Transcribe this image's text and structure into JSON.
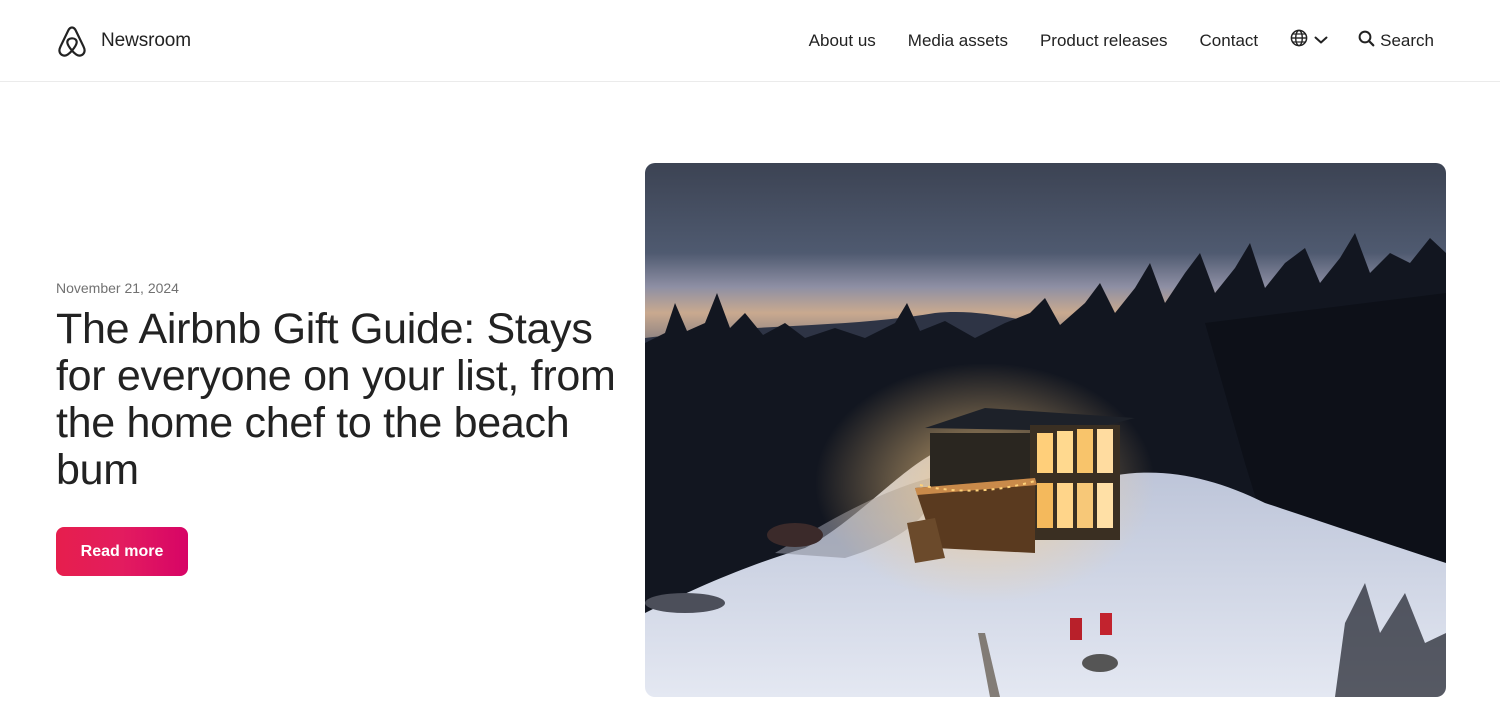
{
  "header": {
    "brand_label": "Newsroom",
    "nav": [
      {
        "label": "About us"
      },
      {
        "label": "Media assets"
      },
      {
        "label": "Product releases"
      },
      {
        "label": "Contact"
      }
    ],
    "language_icon": "globe-icon",
    "search_label": "Search",
    "search_icon": "search-icon"
  },
  "hero": {
    "date": "November 21, 2024",
    "headline": "The Airbnb Gift Guide: Stays for everyone on your list, from the home chef to the beach bum",
    "cta_label": "Read more",
    "image_subject": "snowy-cabin-at-dusk"
  },
  "colors": {
    "brand": "#FF385C",
    "cta_gradient_start": "#E61E4D",
    "cta_gradient_end": "#D70466",
    "text": "#222222",
    "muted": "#717171"
  }
}
